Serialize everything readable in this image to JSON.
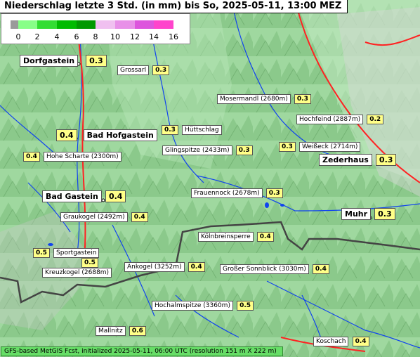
{
  "header": {
    "title": "Niederschlag letzte 3 Std. (in mm) bis So, 2025-05-11, 13:00 MEZ"
  },
  "legend": {
    "ticks": [
      "0",
      "2",
      "4",
      "6",
      "8",
      "10",
      "12",
      "14",
      "16"
    ],
    "colors": [
      "#9a9a9a",
      "#88ff88",
      "#33dd33",
      "#00bb00",
      "#009900",
      "#f0c0f0",
      "#e890e8",
      "#dd55dd",
      "#ff44cc"
    ]
  },
  "places": [
    {
      "name": "Dorfgastein",
      "value": "0.3",
      "type": "town"
    },
    {
      "name": "Grossarl",
      "value": "0.3",
      "type": "site"
    },
    {
      "name": "Mosermandl (2680m)",
      "value": "0.3",
      "type": "site"
    },
    {
      "name": "Hochfeind (2887m)",
      "value": "0.2",
      "type": "site"
    },
    {
      "name": "Bad Hofgastein",
      "value": "0.4",
      "type": "town"
    },
    {
      "name": "Hüttschlag",
      "value": "0.3",
      "type": "site"
    },
    {
      "name": "Hohe Scharte (2300m)",
      "value": "0.4",
      "type": "site"
    },
    {
      "name": "Glingspitze (2433m)",
      "value": "0.3",
      "type": "site"
    },
    {
      "name": "Weißeck (2714m)",
      "value": "0.3",
      "type": "site"
    },
    {
      "name": "Zederhaus",
      "value": "0.3",
      "type": "town"
    },
    {
      "name": "Frauennock (2678m)",
      "value": "0.3",
      "type": "site"
    },
    {
      "name": "Bad Gastein",
      "value": "0.4",
      "type": "town"
    },
    {
      "name": "Graukogel (2492m)",
      "value": "0.4",
      "type": "site"
    },
    {
      "name": "Muhr",
      "value": "0.3",
      "type": "town"
    },
    {
      "name": "Kölnbreinsperre",
      "value": "0.4",
      "type": "site"
    },
    {
      "name": "Sportgastein",
      "value": "0.5",
      "type": "site"
    },
    {
      "name": "Kreuzkogel (2688m)",
      "value": "0.5",
      "type": "site"
    },
    {
      "name": "Ankogel (3252m)",
      "value": "0.4",
      "type": "site"
    },
    {
      "name": "Großer Sonnblick (3030m)",
      "value": "0.4",
      "type": "site"
    },
    {
      "name": "Hochalmspitze (3360m)",
      "value": "0.5",
      "type": "site"
    },
    {
      "name": "Mallnitz",
      "value": "0.6",
      "type": "site"
    },
    {
      "name": "Koschach",
      "value": "0.4",
      "type": "site"
    }
  ],
  "footer": {
    "text": "GFS-based MetGIS Fcst, initialized 2025-05-11, 06:00 UTC  (resolution 151 m X 222 m)"
  }
}
